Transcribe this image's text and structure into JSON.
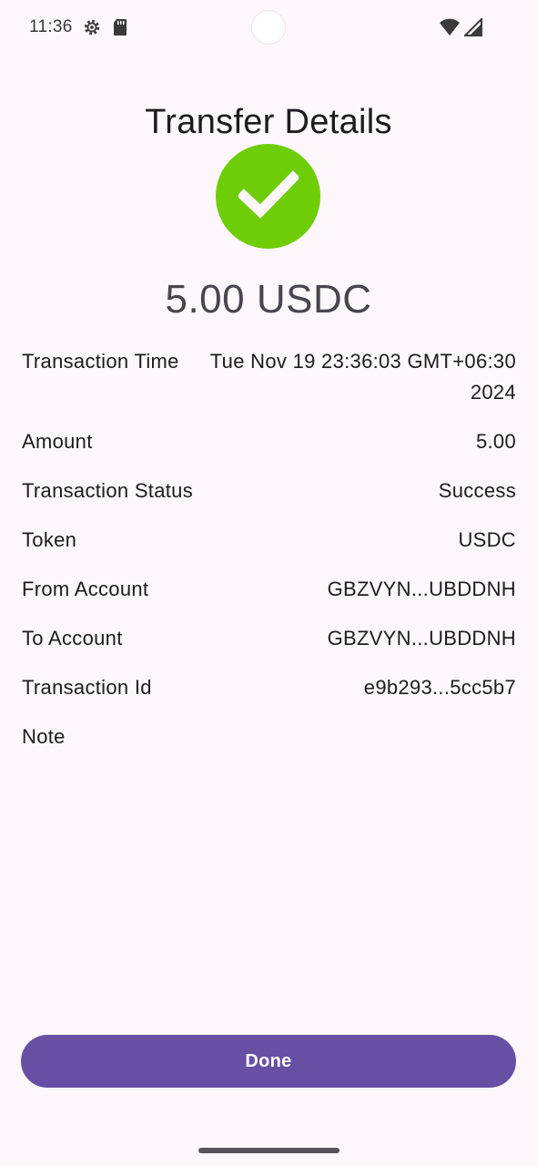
{
  "status_bar": {
    "time": "11:36",
    "icons": [
      "settings-gear-icon",
      "sd-card-icon",
      "wifi-icon",
      "cellular-signal-icon"
    ]
  },
  "header": {
    "title": "Transfer Details"
  },
  "status_icon": "checkmark-icon",
  "colors": {
    "success": "#6fcd08",
    "primary": "#6750a4",
    "background": "#fdf7fc"
  },
  "summary": {
    "amount": "5.00 USDC"
  },
  "details": {
    "transaction_time": {
      "label": "Transaction Time",
      "value": "Tue Nov 19 23:36:03 GMT+06:30 2024"
    },
    "amount": {
      "label": "Amount",
      "value": "5.00"
    },
    "status": {
      "label": "Transaction Status",
      "value": "Success"
    },
    "token": {
      "label": "Token",
      "value": "USDC"
    },
    "from_account": {
      "label": "From Account",
      "value": "GBZVYN...UBDDNH"
    },
    "to_account": {
      "label": "To Account",
      "value": "GBZVYN...UBDDNH"
    },
    "transaction_id": {
      "label": "Transaction Id",
      "value": "e9b293...5cc5b7"
    },
    "note": {
      "label": "Note",
      "value": ""
    }
  },
  "actions": {
    "done_label": "Done"
  }
}
